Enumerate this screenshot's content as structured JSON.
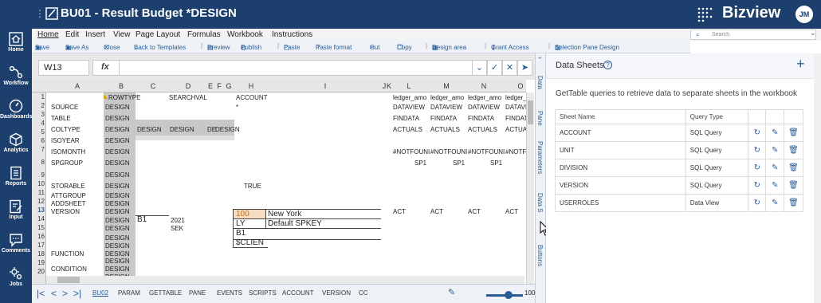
{
  "app": {
    "title": "BU01 - Result Budget *DESIGN",
    "brand": "Bizview",
    "user_initials": "JM"
  },
  "nav": [
    {
      "label": "Home",
      "icon": "home-icon"
    },
    {
      "label": "Workflow",
      "icon": "workflow-icon"
    },
    {
      "label": "Dashboards",
      "icon": "dashboard-icon"
    },
    {
      "label": "Analytics",
      "icon": "cube-icon"
    },
    {
      "label": "Reports",
      "icon": "report-icon"
    },
    {
      "label": "Input",
      "icon": "input-icon"
    },
    {
      "label": "Comments",
      "icon": "comment-icon"
    },
    {
      "label": "Jobs",
      "icon": "jobs-icon"
    }
  ],
  "menu": [
    "Home",
    "Edit",
    "Insert",
    "View",
    "Page Layout",
    "Formulas",
    "Workbook",
    "Instructions"
  ],
  "toolbar": [
    "Save",
    "Save As",
    "Close",
    "Back to Templates",
    "Preview",
    "Publish",
    "Paste",
    "Paste format",
    "Cut",
    "Copy",
    "Design area",
    "Grant Access",
    "Selection Pane Design"
  ],
  "search": {
    "placeholder": "Search"
  },
  "formula": {
    "cell_ref": "W13",
    "fx": "fx",
    "value": ""
  },
  "grid": {
    "columns": [
      "A",
      "B",
      "C",
      "D",
      "E",
      "F",
      "G",
      "H",
      "I",
      "J",
      "K",
      "L",
      "M",
      "N",
      "O"
    ],
    "rows": [
      "1",
      "2",
      "3",
      "4",
      "5",
      "6",
      "7",
      "8",
      "9",
      "10",
      "11",
      "12",
      "13",
      "14",
      "15",
      "16",
      "17",
      "18",
      "19",
      "20"
    ],
    "cells": {
      "b1": "ROWTYPE",
      "d1": "SEARCHVAL",
      "h1": "ACCOUNT",
      "l1": "ledger_amo",
      "m1": "ledger_amo",
      "n1": "ledger_amo",
      "o1": "ledger_amo",
      "a2": "SOURCE",
      "b2": "DESIGN",
      "h2": "*",
      "l2": "DATAVIEW",
      "m2": "DATAVIEW",
      "n2": "DATAVIEW",
      "o2": "DATAVIEW",
      "a3": "TABLE",
      "b3": "DESIGN",
      "l3": "FINDATA",
      "m3": "FINDATA",
      "n3": "FINDATA",
      "o3": "FINDAT",
      "a4": "COLTYPE",
      "b4": "DESIGN",
      "c4": "DESIGN",
      "d4": "DESIGN",
      "ef4": "DE",
      "g4": "DESIGN",
      "l4": "ACTUALS",
      "m4": "ACTUALS",
      "n4": "ACTUALS",
      "o4": "ACTUA",
      "a5": "ISOYEAR",
      "b5": "DESIGN",
      "a6": "ISOMONTH",
      "b6": "DESIGN",
      "l6": "#NOTFOUNI",
      "m6": "#NOTFOUNI",
      "n6": "#NOTFOUNI",
      "o6": "#NOTF",
      "a7": "SPGROUP",
      "b7": "DESIGN",
      "l7": "SP1",
      "m7": "SP1",
      "n7": "SP1",
      "b8": "DESIGN",
      "a9": "STORABLE",
      "b9": "DESIGN",
      "h9": "TRUE",
      "a10": "ATTGROUP",
      "b10": "DESIGN",
      "a11": "ADDSHEET",
      "b11": "DESIGN",
      "a12": "VERSION",
      "b12": "DESIGN",
      "l12": "ACT",
      "m12": "ACT",
      "n12": "ACT",
      "o12": "ACT",
      "b13": "DESIGN",
      "c13": "B1",
      "d13": "2021",
      "h13": "100",
      "i13": "New York",
      "b14": "DESIGN",
      "d14": "SEK",
      "h14": "LY",
      "i14": "Default SPKEY",
      "b15": "DESIGN",
      "h15": "B1",
      "b16": "DESIGN",
      "h16": "$CLIEN",
      "a17": "FUNCTION",
      "b17": "DESIGN",
      "b18": "DESIGN",
      "a19": "CONDITION",
      "b19": "DESIGN",
      "b20": "DESIGN"
    }
  },
  "sheet_tabs": [
    "BU02",
    "PARAM",
    "GETTABLE",
    "PANE",
    "EVENTS",
    "SCRIPTS",
    "ACCOUNT",
    "VERSION",
    "CC"
  ],
  "zoom": {
    "value": "100%",
    "fraction": 0.6
  },
  "side_tabs": [
    "Data",
    "Pane",
    "Parameters",
    "Data S",
    "Buttons"
  ],
  "panel": {
    "title": "Data Sheets",
    "description": "GetTable queries to retrieve data to separate sheets in the workbook",
    "headers": [
      "Sheet Name",
      "Query Type"
    ],
    "rows": [
      {
        "name": "ACCOUNT",
        "type": "SQL Query"
      },
      {
        "name": "UNIT",
        "type": "SQL Query"
      },
      {
        "name": "DIVISION",
        "type": "SQL Query"
      },
      {
        "name": "VERSION",
        "type": "SQL Query"
      },
      {
        "name": "USERROLES",
        "type": "Data View"
      }
    ]
  }
}
